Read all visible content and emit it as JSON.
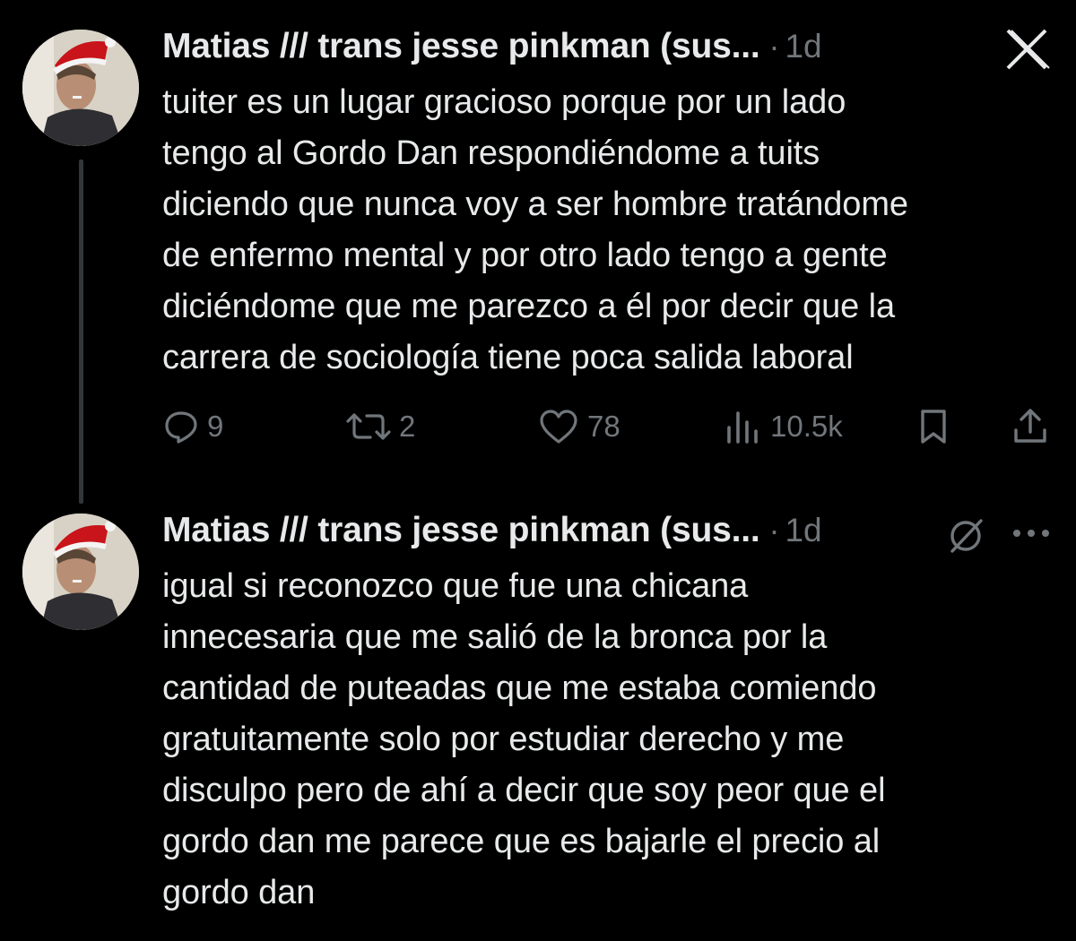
{
  "tweets": [
    {
      "author": "Matias /// trans jesse pinkman (sus...",
      "separator": "·",
      "time": "1d",
      "text": "tuiter es un lugar gracioso porque por un lado\ntengo al Gordo Dan respondiéndome a tuits\ndiciendo que nunca voy a ser hombre tratándome\nde enfermo mental y por otro lado tengo a gente\ndiciéndome que me parezco a él por decir que la\ncarrera de sociología tiene poca salida laboral",
      "actions": {
        "replies": "9",
        "reposts": "2",
        "likes": "78",
        "views": "10.5k"
      }
    },
    {
      "author": "Matias /// trans jesse pinkman (sus...",
      "separator": "·",
      "time": "1d",
      "text": "igual si reconozco que fue una chicana\ninnecesaria que me salió de la bronca por la\ncantidad de puteadas que me estaba comiendo\ngratuitamente solo por estudiar derecho y me\ndisculpo pero de ahí a decir que soy peor que el\ngordo dan me parece que es bajarle el precio al\ngordo dan"
    }
  ],
  "icons": {
    "close": "x-close-icon",
    "reply": "reply-icon",
    "repost": "repost-icon",
    "like": "heart-icon",
    "views": "views-icon",
    "bookmark": "bookmark-icon",
    "share": "share-icon",
    "grok": "grok-icon",
    "more": "more-icon",
    "santa_hat": "santa-hat-icon"
  },
  "colors": {
    "background": "#000000",
    "text": "#e7e9ea",
    "secondary": "#71767b",
    "thread_line": "#333639"
  }
}
